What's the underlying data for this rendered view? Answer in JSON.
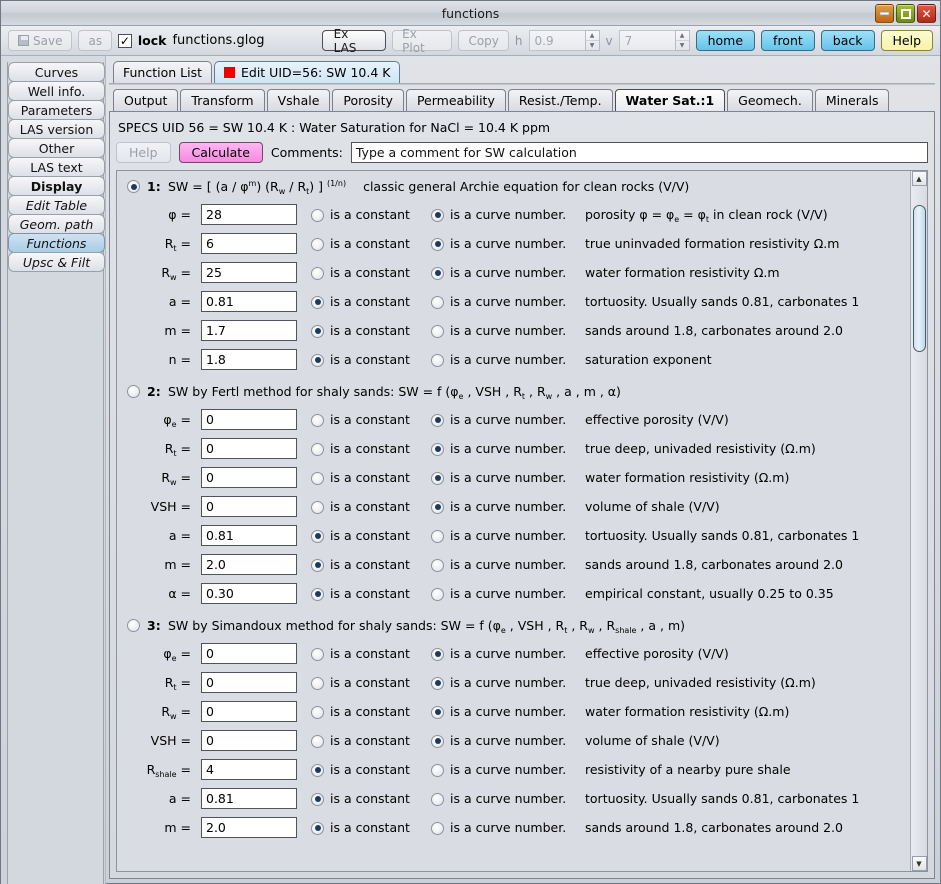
{
  "window": {
    "title": "functions",
    "buttons": {
      "minimize": "–",
      "maximize": "□",
      "close": "✕"
    }
  },
  "toolbar": {
    "save_label": "Save",
    "as_label": "as",
    "lock_label": "lock",
    "lock_checked": "✓",
    "filename": "functions.glog",
    "ex_las_label": "Ex LAS",
    "ex_plot_label": "Ex Plot",
    "copy_label": "Copy",
    "h_label": "h",
    "h_value": "0.9",
    "v_label": "v",
    "v_value": "7",
    "home_label": "home",
    "front_label": "front",
    "back_label": "back",
    "help_label": "Help"
  },
  "sidebar": {
    "items": [
      {
        "label": "Curves",
        "style": "normal",
        "selected": false
      },
      {
        "label": "Well info.",
        "style": "normal",
        "selected": false
      },
      {
        "label": "Parameters",
        "style": "normal",
        "selected": false
      },
      {
        "label": "LAS version",
        "style": "normal",
        "selected": false
      },
      {
        "label": "Other",
        "style": "normal",
        "selected": false
      },
      {
        "label": "LAS text",
        "style": "normal",
        "selected": false
      },
      {
        "label": "Display",
        "style": "bold",
        "selected": false
      },
      {
        "label": "Edit Table",
        "style": "italic",
        "selected": false
      },
      {
        "label": "Geom. path",
        "style": "italic",
        "selected": false
      },
      {
        "label": "Functions",
        "style": "italic",
        "selected": true
      },
      {
        "label": "Upsc & Filt",
        "style": "italic",
        "selected": false
      }
    ]
  },
  "tabs_primary": [
    {
      "label": "Function List",
      "selected": false,
      "icon": ""
    },
    {
      "label": "Edit UID=56: SW 10.4 K",
      "selected": true,
      "icon": "red-square-icon"
    }
  ],
  "tabs_secondary": [
    {
      "label": "Output",
      "selected": false
    },
    {
      "label": "Transform",
      "selected": false
    },
    {
      "label": "Vshale",
      "selected": false
    },
    {
      "label": "Porosity",
      "selected": false
    },
    {
      "label": "Permeability",
      "selected": false
    },
    {
      "label": "Resist./Temp.",
      "selected": false
    },
    {
      "label": "Water Sat.:1",
      "selected": true
    },
    {
      "label": "Geomech.",
      "selected": false
    },
    {
      "label": "Minerals",
      "selected": false
    }
  ],
  "panel": {
    "specs": "SPECS UID 56 = SW 10.4 K : Water Saturation for NaCl = 10.4 K ppm",
    "help_label": "Help",
    "calculate_label": "Calculate",
    "comments_label": "Comments:",
    "comments_value": "Type a comment for SW calculation"
  },
  "option_labels": {
    "constant": "is a constant",
    "curve": "is a curve number."
  },
  "functions": [
    {
      "number": "1:",
      "selected": true,
      "formula_html": "SW = [ (a / &phi;<sup>m</sup>) (R<sub>w</sub> / R<sub>t</sub>) ] <sup>(1/n)</sup>",
      "description": "classic general Archie equation for clean rocks (V/V)",
      "params": [
        {
          "label_html": "&phi; =",
          "value": "28",
          "mode": "curve",
          "desc_html": "porosity &phi; = &phi;<sub>e</sub> = &phi;<sub>t</sub> in clean rock (V/V)"
        },
        {
          "label_html": "R<sub>t</sub> =",
          "value": "6",
          "mode": "curve",
          "desc_html": "true uninvaded formation resistivity &Omega;.m"
        },
        {
          "label_html": "R<sub>w</sub> =",
          "value": "25",
          "mode": "curve",
          "desc_html": "water formation resistivity &Omega;.m"
        },
        {
          "label_html": "a =",
          "value": "0.81",
          "mode": "constant",
          "desc_html": "tortuosity. Usually sands 0.81, carbonates 1"
        },
        {
          "label_html": "m =",
          "value": "1.7",
          "mode": "constant",
          "desc_html": "sands around 1.8, carbonates around 2.0"
        },
        {
          "label_html": "n =",
          "value": "1.8",
          "mode": "constant",
          "desc_html": "saturation exponent"
        }
      ]
    },
    {
      "number": "2:",
      "selected": false,
      "formula_html": "SW by Fertl method for shaly sands: SW = f (&phi;<sub>e</sub> , VSH , R<sub>t</sub> , R<sub>w</sub> , a , m , &alpha;)",
      "description": "",
      "params": [
        {
          "label_html": "&phi;<sub>e</sub> =",
          "value": "0",
          "mode": "curve",
          "desc_html": "effective porosity (V/V)"
        },
        {
          "label_html": "R<sub>t</sub> =",
          "value": "0",
          "mode": "curve",
          "desc_html": "true deep, univaded resistivity (&Omega;.m)"
        },
        {
          "label_html": "R<sub>w</sub> =",
          "value": "0",
          "mode": "curve",
          "desc_html": "water formation resistivity (&Omega;.m)"
        },
        {
          "label_html": "VSH =",
          "value": "0",
          "mode": "curve",
          "desc_html": "volume of shale (V/V)"
        },
        {
          "label_html": "a =",
          "value": "0.81",
          "mode": "constant",
          "desc_html": "tortuosity. Usually sands 0.81, carbonates 1"
        },
        {
          "label_html": "m =",
          "value": "2.0",
          "mode": "constant",
          "desc_html": "sands around 1.8, carbonates around 2.0"
        },
        {
          "label_html": "&alpha; =",
          "value": "0.30",
          "mode": "constant",
          "desc_html": "empirical constant, usually 0.25 to 0.35"
        }
      ]
    },
    {
      "number": "3:",
      "selected": false,
      "formula_html": "SW by Simandoux method for shaly sands: SW = f (&phi;<sub>e</sub> , VSH , R<sub>t</sub> , R<sub>w</sub> , R<sub>shale</sub> , a , m)",
      "description": "",
      "params": [
        {
          "label_html": "&phi;<sub>e</sub> =",
          "value": "0",
          "mode": "curve",
          "desc_html": "effective porosity (V/V)"
        },
        {
          "label_html": "R<sub>t</sub> =",
          "value": "0",
          "mode": "curve",
          "desc_html": "true deep, univaded resistivity (&Omega;.m)"
        },
        {
          "label_html": "R<sub>w</sub> =",
          "value": "0",
          "mode": "curve",
          "desc_html": "water formation resistivity (&Omega;.m)"
        },
        {
          "label_html": "VSH =",
          "value": "0",
          "mode": "curve",
          "desc_html": "volume of shale (V/V)"
        },
        {
          "label_html": "R<sub>shale</sub> =",
          "value": "4",
          "mode": "constant",
          "desc_html": "resistivity of a nearby pure shale"
        },
        {
          "label_html": "a =",
          "value": "0.81",
          "mode": "constant",
          "desc_html": "tortuosity. Usually sands 0.81, carbonates 1"
        },
        {
          "label_html": "m =",
          "value": "2.0",
          "mode": "constant",
          "desc_html": "sands around 1.8, carbonates around 2.0"
        }
      ]
    }
  ],
  "scrollbar": {
    "up_arrow": "▲",
    "down_arrow": "▼"
  },
  "colors": {
    "accent_blue": "#63c4ea",
    "help_yellow": "#f7f3a8",
    "calculate_pink": "#f58ae0",
    "tab_selected": "#cfe5f4",
    "red_square": "#ef0000"
  }
}
